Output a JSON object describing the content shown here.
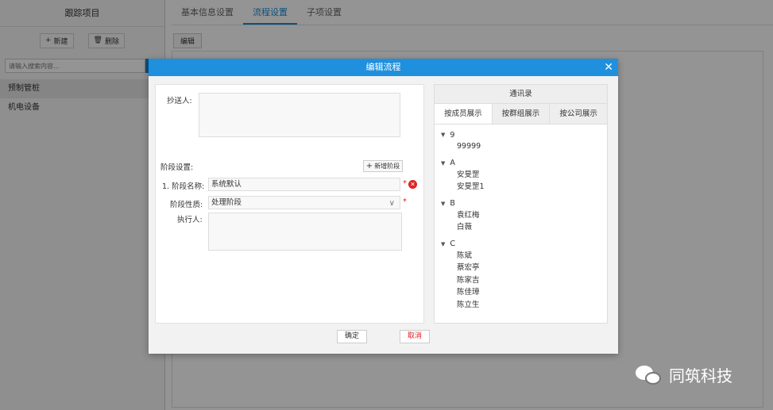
{
  "left": {
    "title": "跟踪项目",
    "new_label": "新建",
    "delete_label": "删除",
    "search_placeholder": "请输入搜索内容...",
    "items": [
      "预制管桩",
      "机电设备"
    ]
  },
  "tabs": [
    "基本信息设置",
    "流程设置",
    "子项设置"
  ],
  "edit_label": "编辑",
  "modal": {
    "title": "编辑流程",
    "close": "✕",
    "cc_label": "抄送人:",
    "stage_settings_label": "阶段设置:",
    "add_stage_label": "新增阶段",
    "stage_name_label": "1. 阶段名称:",
    "stage_name_value": "系统默认",
    "stage_nature_label": "阶段性质:",
    "stage_nature_value": "处理阶段",
    "executor_label": "执行人:",
    "required_mark": "*",
    "contacts": {
      "title": "通讯录",
      "tabs": [
        "按成员展示",
        "按群组展示",
        "按公司展示"
      ],
      "groups": [
        {
          "key": "9",
          "members": [
            "99999"
          ]
        },
        {
          "key": "A",
          "members": [
            "安旻罡",
            "安旻罡1"
          ]
        },
        {
          "key": "B",
          "members": [
            "袁红梅",
            "白薇"
          ]
        },
        {
          "key": "C",
          "members": [
            "陈斌",
            "蔡宏亭",
            "陈家吉",
            "陈佳璋",
            "陈立生"
          ]
        }
      ]
    },
    "confirm_label": "确定",
    "cancel_label": "取消"
  },
  "watermark": "同筑科技",
  "colors": {
    "accent": "#1e90dd",
    "required": "#dd2222"
  }
}
